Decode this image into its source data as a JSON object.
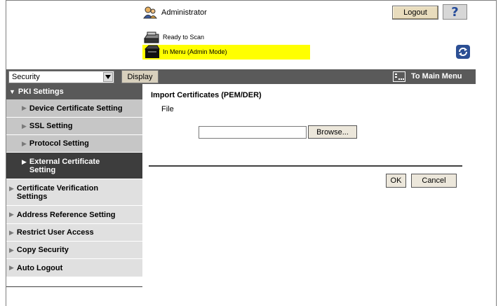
{
  "header": {
    "user_label": "Administrator",
    "logout_label": "Logout",
    "help_label": "?",
    "status_ready": "Ready to Scan",
    "status_mode": "In Menu (Admin Mode)"
  },
  "toolbar": {
    "category_value": "Security",
    "display_label": "Display",
    "main_menu_label": "To Main Menu"
  },
  "sidebar": {
    "items": [
      {
        "label": "PKI Settings"
      },
      {
        "label": "Device Certificate Setting"
      },
      {
        "label": "SSL Setting"
      },
      {
        "label": "Protocol Setting"
      },
      {
        "label": "External Certificate Setting"
      },
      {
        "label": "Certificate Verification Settings"
      },
      {
        "label": "Address Reference Setting"
      },
      {
        "label": "Restrict User Access"
      },
      {
        "label": "Copy Security"
      },
      {
        "label": "Auto Logout"
      }
    ]
  },
  "main": {
    "title": "Import Certificates (PEM/DER)",
    "file_label": "File",
    "file_value": "",
    "browse_label": "Browse...",
    "ok_label": "OK",
    "cancel_label": "Cancel"
  },
  "colors": {
    "status_highlight": "#ffff00",
    "toolbar_bg": "#5a5a5a",
    "sidebar_active": "#3d3d3d"
  }
}
